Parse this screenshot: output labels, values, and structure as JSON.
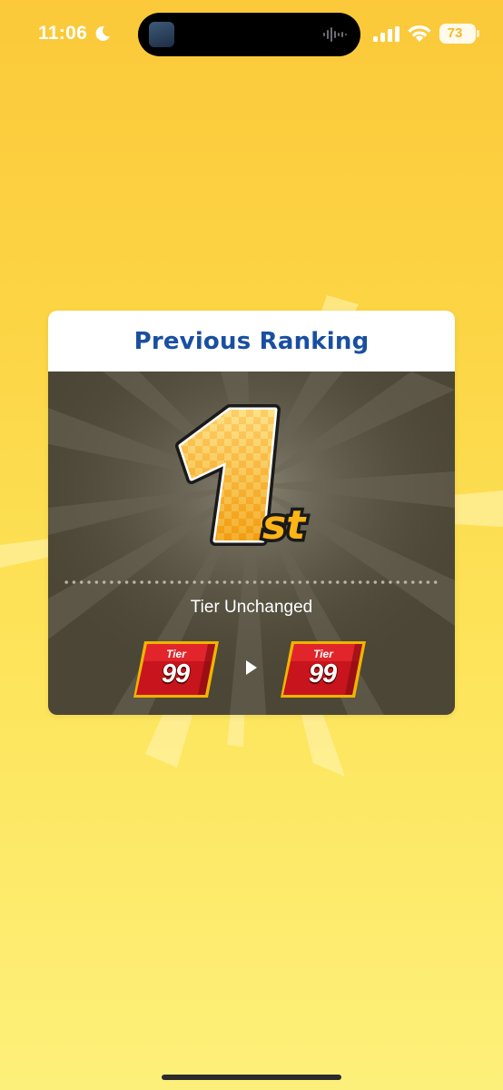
{
  "status_bar": {
    "time": "11:06",
    "battery": "73"
  },
  "card": {
    "title": "Previous Ranking",
    "rank_number": "1",
    "rank_suffix": "st",
    "tier_status": "Tier Unchanged",
    "tier_from": {
      "label": "Tier",
      "value": "99"
    },
    "tier_to": {
      "label": "Tier",
      "value": "99"
    }
  },
  "colors": {
    "background_top": "#fbc93a",
    "background_bottom": "#fdf07a",
    "title_blue": "#1a4fa0",
    "card_body": "#4b4636",
    "badge_red": "#c8141c",
    "badge_gold": "#f0b400"
  },
  "icons": [
    "moon-icon",
    "signal-icon",
    "wifi-icon",
    "battery-icon",
    "arrow-right-icon"
  ]
}
